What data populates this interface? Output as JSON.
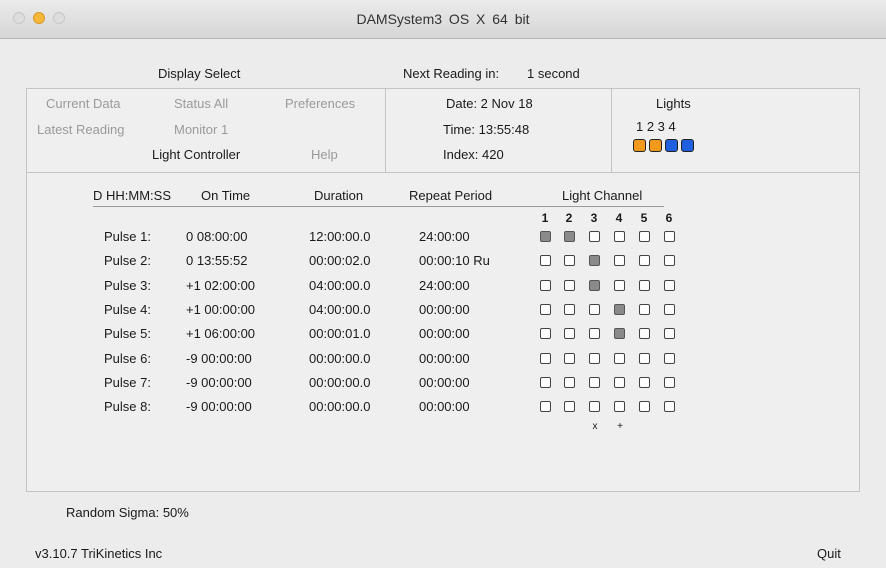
{
  "window": {
    "title": "DAMSystem3   OS X 64 bit"
  },
  "display_select": {
    "label": "Display Select",
    "items": [
      "Current Data",
      "Status All",
      "Preferences",
      "Latest Reading",
      "Monitor 1",
      "Light Controller",
      "Help"
    ],
    "active": "Light Controller"
  },
  "next_reading": {
    "label": "Next Reading in:",
    "value": "1 second"
  },
  "status": {
    "date": "Date:  2 Nov 18",
    "time": "Time:  13:55:48",
    "index": "Index:  420"
  },
  "lights": {
    "label": "Lights",
    "numbers": "1  2  3  4",
    "colors": [
      "#f39a1c",
      "#f39a1c",
      "#1f5fe0",
      "#1f5fe0"
    ]
  },
  "table": {
    "headers": [
      "D HH:MM:SS",
      "On Time",
      "Duration",
      "Repeat Period",
      "Light Channel"
    ],
    "channels": [
      "1",
      "2",
      "3",
      "4",
      "5",
      "6"
    ],
    "rows": [
      {
        "label": "Pulse 1:",
        "on_time": "0  08:00:00",
        "duration": "12:00:00.0",
        "repeat": "24:00:00",
        "channels": [
          true,
          true,
          false,
          false,
          false,
          false
        ]
      },
      {
        "label": "Pulse 2:",
        "on_time": "0  13:55:52",
        "duration": "00:00:02.0",
        "repeat": "00:00:10 Ru",
        "channels": [
          false,
          false,
          true,
          false,
          false,
          false
        ]
      },
      {
        "label": "Pulse 3:",
        "on_time": "+1 02:00:00",
        "duration": "04:00:00.0",
        "repeat": "24:00:00",
        "channels": [
          false,
          false,
          true,
          false,
          false,
          false
        ]
      },
      {
        "label": "Pulse 4:",
        "on_time": "+1 00:00:00",
        "duration": "04:00:00.0",
        "repeat": "00:00:00",
        "channels": [
          false,
          false,
          false,
          true,
          false,
          false
        ]
      },
      {
        "label": "Pulse 5:",
        "on_time": "+1 06:00:00",
        "duration": "00:00:01.0",
        "repeat": "00:00:00",
        "channels": [
          false,
          false,
          false,
          true,
          false,
          false
        ]
      },
      {
        "label": "Pulse 6:",
        "on_time": "-9 00:00:00",
        "duration": "00:00:00.0",
        "repeat": "00:00:00",
        "channels": [
          false,
          false,
          false,
          false,
          false,
          false
        ]
      },
      {
        "label": "Pulse 7:",
        "on_time": "-9 00:00:00",
        "duration": "00:00:00.0",
        "repeat": "00:00:00",
        "channels": [
          false,
          false,
          false,
          false,
          false,
          false
        ]
      },
      {
        "label": "Pulse 8:",
        "on_time": "-9 00:00:00",
        "duration": "00:00:00.0",
        "repeat": "00:00:00",
        "channels": [
          false,
          false,
          false,
          false,
          false,
          false
        ]
      }
    ],
    "channel_marks": [
      "",
      "",
      "x",
      "+",
      "",
      ""
    ]
  },
  "random_sigma": "Random Sigma: 50%",
  "footer": {
    "version": "v3.10.7  TriKinetics Inc",
    "quit": "Quit"
  }
}
